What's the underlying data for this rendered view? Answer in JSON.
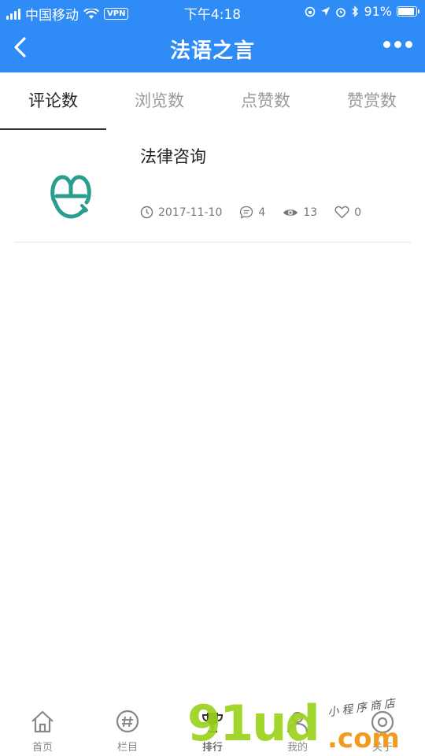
{
  "status_bar": {
    "carrier": "中国移动",
    "vpn_label": "VPN",
    "time": "下午4:18",
    "battery_percent": "91%",
    "battery_level": 0.91
  },
  "nav": {
    "title": "法语之言",
    "back_icon": "chevron-left-icon",
    "more_icon": "more-dots-icon"
  },
  "tabs": [
    {
      "label": "评论数",
      "active": true
    },
    {
      "label": "浏览数",
      "active": false
    },
    {
      "label": "点赞数",
      "active": false
    },
    {
      "label": "赞赏数",
      "active": false
    }
  ],
  "list": [
    {
      "title": "法律咨询",
      "date": "2017-11-10",
      "comments": "4",
      "views": "13",
      "likes": "0"
    }
  ],
  "tabbar": [
    {
      "label": "首页",
      "icon": "home-icon"
    },
    {
      "label": "栏目",
      "icon": "hashtag-icon"
    },
    {
      "label": "排行",
      "icon": "trophy-icon",
      "active": true
    },
    {
      "label": "我的",
      "icon": "user-icon"
    },
    {
      "label": "关于",
      "icon": "about-icon"
    }
  ],
  "watermark": {
    "big": "91ud",
    "com": ".com",
    "small": "小程序商店"
  },
  "colors": {
    "header": "#2f8bf5",
    "logo_teal": "#2a9d8f"
  }
}
